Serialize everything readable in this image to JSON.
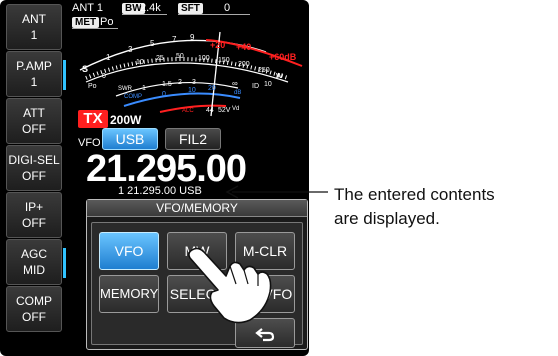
{
  "side_menu": [
    {
      "label": "ANT",
      "value": "1"
    },
    {
      "label": "P.AMP",
      "value": "1"
    },
    {
      "label": "ATT",
      "value": "OFF"
    },
    {
      "label": "DIGI-SEL",
      "value": "OFF"
    },
    {
      "label": "IP+",
      "value": "OFF"
    },
    {
      "label": "AGC",
      "value": "MID"
    },
    {
      "label": "COMP",
      "value": "OFF"
    }
  ],
  "status": {
    "ant": "ANT 1",
    "bw_label": "BW",
    "bw_value": "2.4k",
    "sft_label": "SFT",
    "sft_value": "0",
    "met_label": "MET",
    "met_value": "Po"
  },
  "meter": {
    "s_scale": [
      "S",
      "1",
      "3",
      "5",
      "7",
      "9",
      "+20",
      "+40",
      "+60dB"
    ],
    "po_scale": [
      "Po",
      "0",
      "10",
      "25",
      "50",
      "100",
      "150",
      "200",
      "250",
      "W"
    ],
    "swr_scale": [
      "SWR",
      "1",
      "1.5",
      "2",
      "3",
      "∞"
    ],
    "comp_scale": [
      "COMP",
      "0",
      "10",
      "20",
      "dB"
    ],
    "alc_label": "ALC",
    "id_label": "ID",
    "vd_scale": [
      "10",
      "20",
      "25",
      "A"
    ],
    "vd_low": [
      "44",
      "52V",
      "Vd"
    ],
    "colors": {
      "scale": "#ffffff",
      "red": "#ff2020",
      "blue": "#3a8cff",
      "needle": "#ffffff"
    }
  },
  "tx": {
    "badge": "TX",
    "power": "200W"
  },
  "vfo": {
    "label": "VFO",
    "mode": "USB",
    "filter": "FIL2",
    "frequency": "21.295.00",
    "subline": "1  21.295.00  USB"
  },
  "dialog": {
    "title": "VFO/MEMORY",
    "buttons": {
      "vfo": "VFO",
      "mw": "MW",
      "mclr": "M-CLR",
      "memory": "MEMORY",
      "select": "SELECT",
      "mvfo": "M→VFO"
    }
  },
  "callout": {
    "line1": "The entered contents",
    "line2": "are displayed."
  }
}
